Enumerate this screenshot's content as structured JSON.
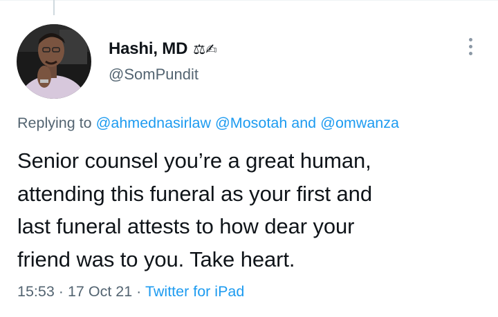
{
  "author": {
    "display_name": "Hashi, MD",
    "emojis": "⚖✍",
    "handle": "@SomPundit"
  },
  "replying": {
    "prefix": "Replying to",
    "mentions": [
      "@ahmednasirlaw",
      "@Mosotah",
      "@omwanza"
    ],
    "conjunction": "and"
  },
  "tweet": {
    "lines": [
      "Senior counsel you’re a great human,",
      "attending this funeral as your first and",
      "last funeral attests to how dear your",
      "friend was to you. Take heart."
    ]
  },
  "meta": {
    "time": "15:53",
    "separator": "·",
    "date": "17 Oct 21",
    "source": "Twitter for iPad"
  },
  "colors": {
    "text": "#0f1419",
    "secondary": "#536471",
    "link": "#1d9bf0"
  },
  "icons": {
    "more": "more-vertical-icon"
  }
}
